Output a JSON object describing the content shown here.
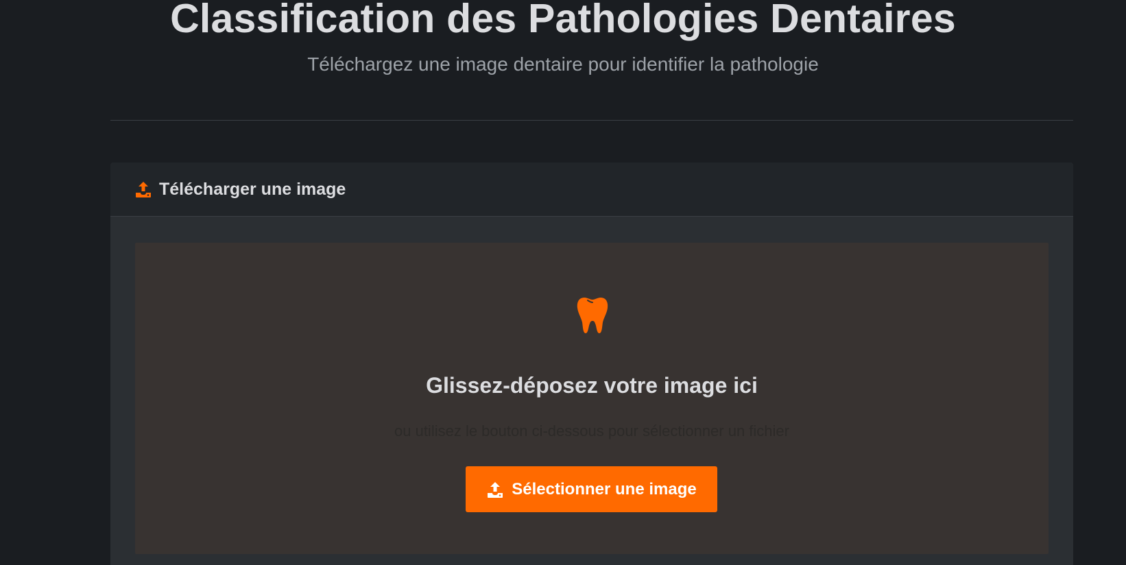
{
  "header": {
    "title": "Classification des Pathologies Dentaires",
    "subtitle": "Téléchargez une image dentaire pour identifier la pathologie"
  },
  "upload_card": {
    "title": "Télécharger une image",
    "title_icon": "upload-icon",
    "dropzone": {
      "icon": "tooth-icon",
      "title": "Glissez-déposez votre image ici",
      "hint": "ou utilisez le bouton ci-dessous pour sélectionner un fichier",
      "button_label": "Sélectionner une image",
      "button_icon": "upload-icon"
    }
  },
  "colors": {
    "accent": "#ff6a00",
    "background": "#1a1d21",
    "card_header": "#212529",
    "card_body": "#2b2f33",
    "dropzone": "#383331",
    "text": "#dcdde0"
  }
}
